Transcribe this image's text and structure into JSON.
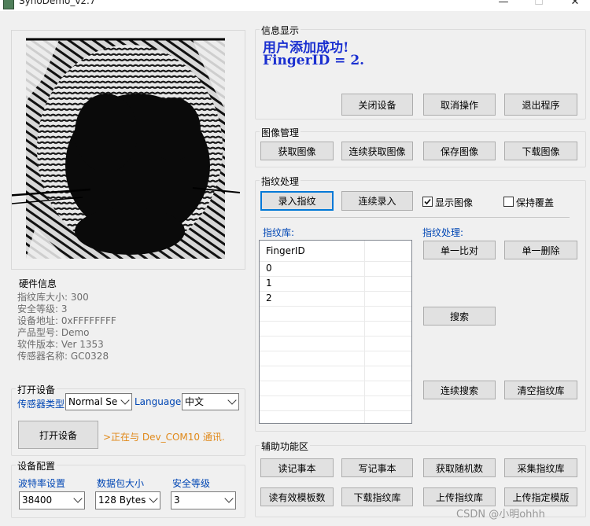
{
  "window": {
    "title": "SynoDemo_v2.7",
    "minimize": "—",
    "maximize": "☐",
    "close": "✕"
  },
  "info_display": {
    "title": "信息显示",
    "line1": "用户添加成功!",
    "line2": "FingerID = 2.",
    "close_device": "关闭设备",
    "cancel_op": "取消操作",
    "exit_program": "退出程序"
  },
  "image_mgmt": {
    "title": "图像管理",
    "get_image": "获取图像",
    "continuous_get_image": "连续获取图像",
    "save_image": "保存图像",
    "download_image": "下载图像"
  },
  "fp_process": {
    "title": "指纹处理",
    "enroll": "录入指纹",
    "continuous_enroll": "连续录入",
    "show_image": "显示图像",
    "show_image_checked": true,
    "keep_overwrite": "保持覆盖",
    "keep_overwrite_checked": false,
    "library_label": "指纹库:",
    "process_label": "指纹处理:",
    "list_header": "FingerID",
    "list_rows": [
      "0",
      "1",
      "2"
    ],
    "single_match": "单一比对",
    "single_delete": "单一删除",
    "search": "搜索",
    "continuous_search": "连续搜索",
    "clear_library": "清空指纹库"
  },
  "aux": {
    "title": "辅助功能区",
    "read_notepad": "读记事本",
    "write_notepad": "写记事本",
    "get_random": "获取随机数",
    "collect_library": "采集指纹库",
    "read_valid_templates": "读有效模板数",
    "download_library": "下载指纹库",
    "upload_library": "上传指纹库",
    "upload_template": "上传指定模版"
  },
  "hardware": {
    "title": "硬件信息",
    "lines": [
      "指纹库大小: 300",
      "安全等级: 3",
      "设备地址: 0xFFFFFFFF",
      "产品型号:   Demo",
      "软件版本: Ver 1353",
      "传感器名称: GC0328"
    ]
  },
  "open_device": {
    "title": "打开设备",
    "sensor_type_label": "传感器类型",
    "sensor_type_value": "Normal Ser",
    "language_label": "Language",
    "language_value": "中文",
    "open_button": "打开设备",
    "status": ">正在与 Dev_COM10 通讯."
  },
  "device_config": {
    "title": "设备配置",
    "baud_label": "波特率设置",
    "baud_value": "38400",
    "packet_label": "数据包大小",
    "packet_value": "128 Bytes",
    "security_label": "安全等级",
    "security_value": "3"
  },
  "watermark": "CSDN @小明ohhh",
  "colors": {
    "accent_blue": "#0046b4",
    "message_blue": "#1a2fd0",
    "status_orange": "#e0891a",
    "default_button_border": "#0078d7"
  }
}
